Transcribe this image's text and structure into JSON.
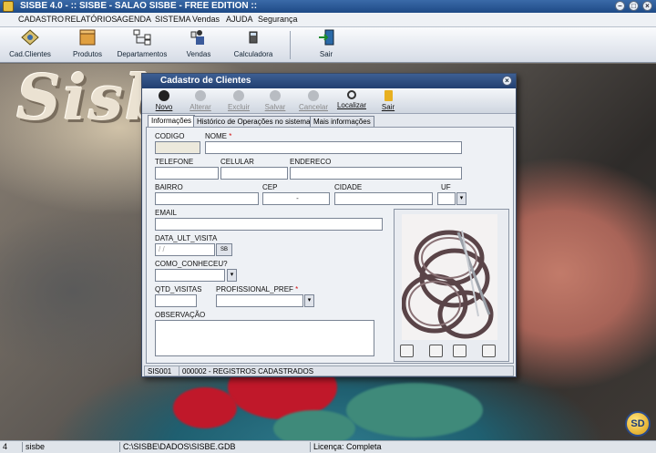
{
  "window": {
    "title": "SISBE 4.0 - :: SISBE - SALAO SISBE - FREE EDITION ::"
  },
  "menu": [
    "CADASTRO",
    "RELATÓRIOS",
    "AGENDA",
    "SISTEMA",
    "Vendas",
    "AJUDA",
    "Segurança"
  ],
  "toolbar": [
    "Cad.Clientes",
    "Produtos",
    "Departamentos",
    "Vendas",
    "Calculadora",
    "Sair"
  ],
  "background_text": "Sisbe",
  "corner_logo": "SD",
  "statusbar": {
    "num": "4",
    "user": "sisbe",
    "db_path": "C:\\SISBE\\DADOS\\SISBE.GDB",
    "license": "Licença: Completa"
  },
  "dialog": {
    "title": "Cadastro de Clientes",
    "toolbar": [
      "Novo",
      "Alterar",
      "Excluir",
      "Salvar",
      "Cancelar",
      "Localizar",
      "Sair"
    ],
    "tabs": [
      "Informações",
      "Histórico de Operações no sistema",
      "Mais informações"
    ],
    "labels": {
      "codigo": "CODIGO",
      "nome": "NOME",
      "telefone": "TELEFONE",
      "celular": "CELULAR",
      "endereco": "ENDERECO",
      "bairro": "BAIRRO",
      "cep": "CEP",
      "cidade": "CIDADE",
      "uf": "UF",
      "email": "EMAIL",
      "data_ult_visita": "DATA_ULT_VISITA",
      "como_conheceu": "COMO_CONHECEU?",
      "qtd_visitas": "QTD_VISITAS",
      "profissional_pref": "PROFISSIONAL_PREF",
      "observacao": "OBSERVAÇÃO"
    },
    "required_mark": "*",
    "values": {
      "cep": "-",
      "data_ult_visita": "/ /",
      "date_btn": "SB"
    },
    "status": {
      "user": "SIS001",
      "records": "000002 - REGISTROS CADASTRADOS"
    }
  }
}
